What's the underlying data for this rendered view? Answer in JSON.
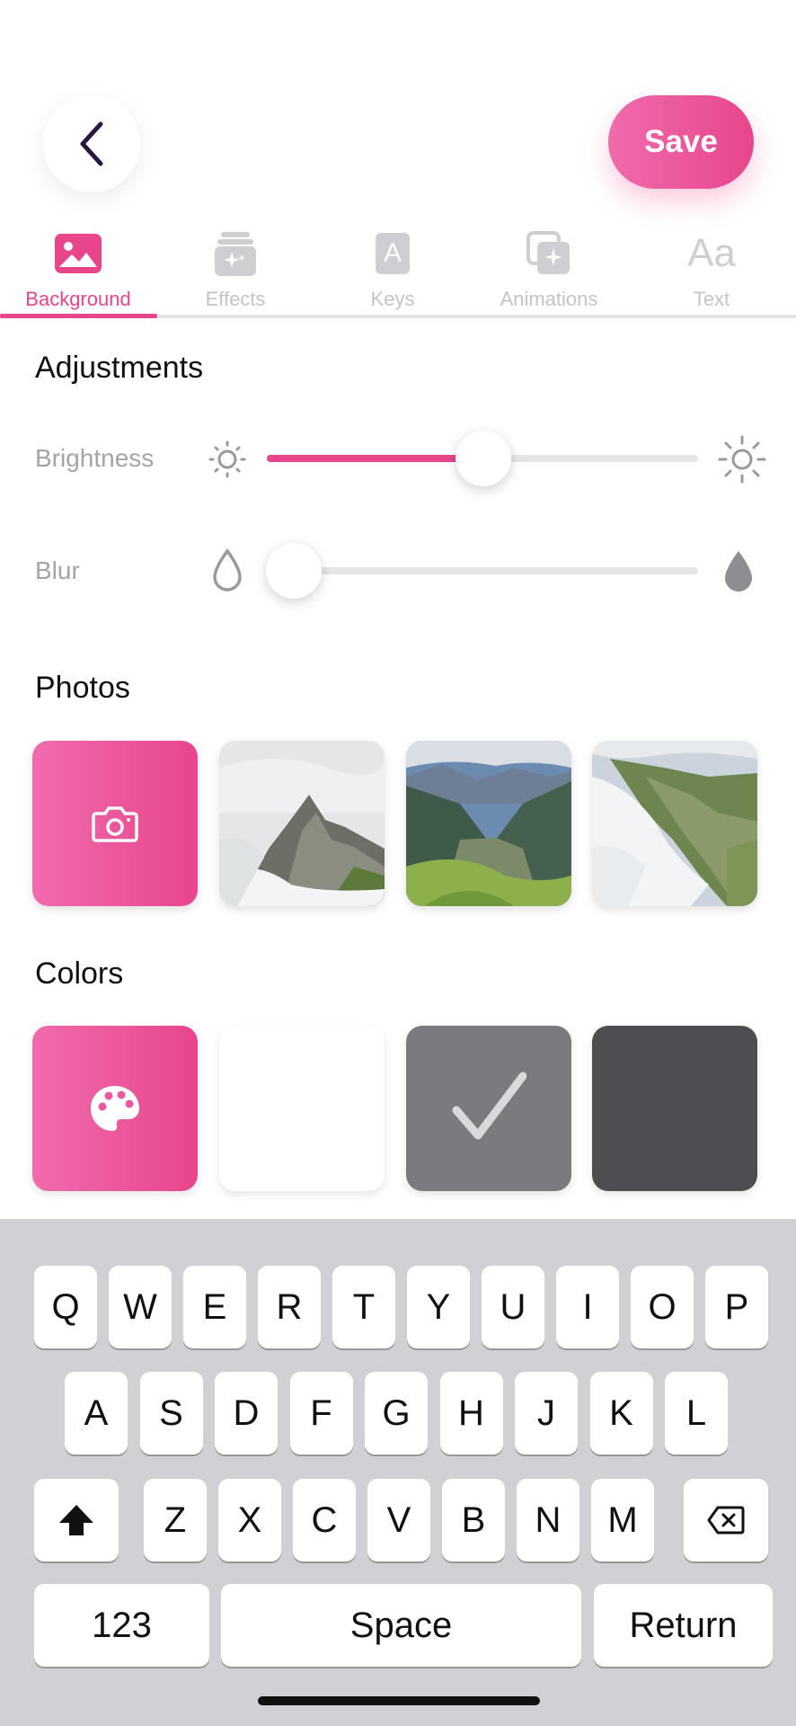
{
  "header": {
    "save_label": "Save"
  },
  "tabs": [
    {
      "label": "Background",
      "icon": "image-icon",
      "active": true
    },
    {
      "label": "Effects",
      "icon": "effects-icon",
      "active": false
    },
    {
      "label": "Keys",
      "icon": "key-letter-icon",
      "active": false
    },
    {
      "label": "Animations",
      "icon": "animations-icon",
      "active": false
    },
    {
      "label": "Text",
      "icon": "text-aa-icon",
      "active": false
    }
  ],
  "tab_text_glyph": "Aa",
  "key_glyph": "A",
  "adjustments": {
    "title": "Adjustments",
    "brightness": {
      "label": "Brightness",
      "value": 0.5
    },
    "blur": {
      "label": "Blur",
      "value": 0.0
    }
  },
  "photos": {
    "title": "Photos"
  },
  "colors": {
    "title": "Colors",
    "swatches": [
      "#ffffff",
      "#7b7a7e",
      "#4e4d51"
    ],
    "selected": 1
  },
  "keyboard": {
    "row1": [
      "Q",
      "W",
      "E",
      "R",
      "T",
      "Y",
      "U",
      "I",
      "O",
      "P"
    ],
    "row2": [
      "A",
      "S",
      "D",
      "F",
      "G",
      "H",
      "J",
      "K",
      "L"
    ],
    "row3": [
      "Z",
      "X",
      "C",
      "V",
      "B",
      "N",
      "M"
    ],
    "numbers_label": "123",
    "space_label": "Space",
    "return_label": "Return"
  },
  "theme": {
    "accent": "#e8458c",
    "accent_light": "#f06bad"
  }
}
